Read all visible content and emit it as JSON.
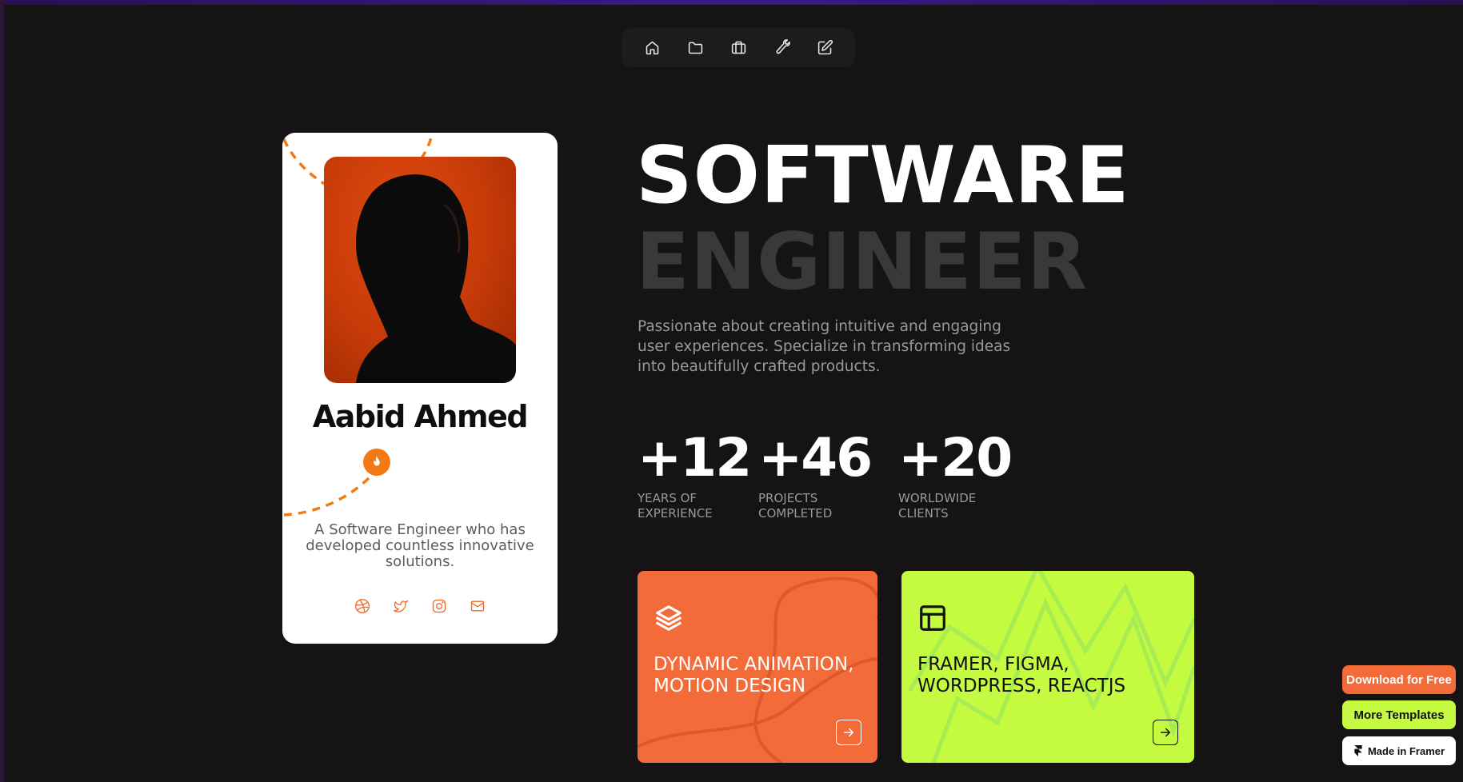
{
  "nav": {
    "items": [
      {
        "name": "home",
        "icon": "home-icon"
      },
      {
        "name": "projects",
        "icon": "folder-icon"
      },
      {
        "name": "experience",
        "icon": "briefcase-icon"
      },
      {
        "name": "tools",
        "icon": "wrench-icon"
      },
      {
        "name": "contact",
        "icon": "edit-icon"
      }
    ]
  },
  "profile": {
    "name": "Aabid Ahmed",
    "badge_icon": "fire-icon",
    "bio": "A Software Engineer who has developed countless innovative solutions.",
    "socials": [
      "dribbble-icon",
      "twitter-icon",
      "instagram-icon",
      "mail-icon"
    ]
  },
  "hero": {
    "line1": "SOFTWARE",
    "line2": "ENGINEER",
    "description": "Passionate about creating intuitive and engaging user experiences. Specialize in transforming ideas into beautifully crafted products."
  },
  "stats": [
    {
      "value": "+12",
      "label_1": "YEARS OF",
      "label_2": "EXPERIENCE"
    },
    {
      "value": "+46",
      "label_1": "PROJECTS",
      "label_2": "COMPLETED"
    },
    {
      "value": "+20",
      "label_1": "WORLDWIDE",
      "label_2": "CLIENTS"
    }
  ],
  "services": [
    {
      "title_1": "DYNAMIC ANIMATION,",
      "title_2": "MOTION DESIGN",
      "icon": "layers-icon",
      "color": "#f26b38"
    },
    {
      "title_1": "FRAMER, FIGMA,",
      "title_2": "WORDPRESS, REACTJS",
      "icon": "layout-icon",
      "color": "#c4fa40"
    }
  ],
  "framer_badges": {
    "download": "Download for Free",
    "templates": "More Templates",
    "made_in": "Made in Framer"
  },
  "colors": {
    "accent_orange": "#f26b38",
    "accent_lime": "#c4fa40",
    "background": "#151313"
  }
}
